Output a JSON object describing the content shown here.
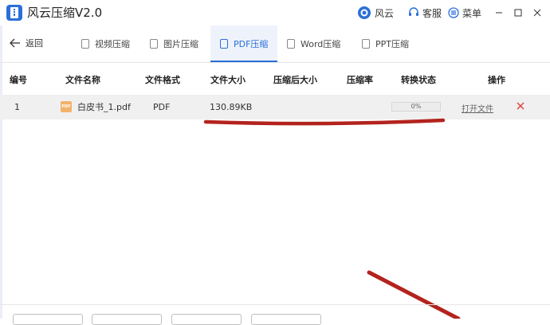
{
  "app": {
    "title": "风云压缩V2.0"
  },
  "titlebar": {
    "brand_label": "风云",
    "service_label": "客服",
    "menu_label": "菜单"
  },
  "nav": {
    "back_label": "返回",
    "tabs": [
      {
        "label": "视频压缩",
        "active": false
      },
      {
        "label": "图片压缩",
        "active": false
      },
      {
        "label": "PDF压缩",
        "active": true
      },
      {
        "label": "Word压缩",
        "active": false
      },
      {
        "label": "PPT压缩",
        "active": false
      }
    ]
  },
  "table": {
    "columns": [
      "编号",
      "文件名称",
      "文件格式",
      "文件大小",
      "压缩后大小",
      "压缩率",
      "转换状态",
      "操作"
    ],
    "rows": [
      {
        "index": "1",
        "name": "白皮书_1.pdf",
        "format": "PDF",
        "size": "130.89KB",
        "compressed_size": "",
        "ratio": "",
        "progress_text": "0%",
        "progress": 0,
        "action": "打开文件"
      }
    ]
  },
  "icons": {
    "pdf_badge": "PDF"
  },
  "colors": {
    "accent": "#2b6fd8",
    "annotation": "#b3231d",
    "delete": "#e0453a"
  }
}
